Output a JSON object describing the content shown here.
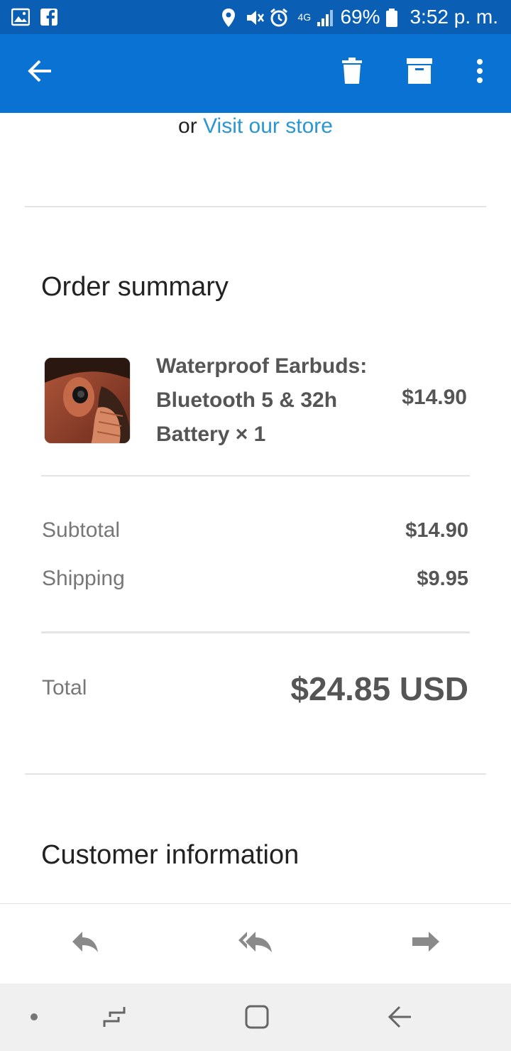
{
  "status_bar": {
    "battery": "69%",
    "network": "4G",
    "time": "3:52 p. m.",
    "icons": [
      "gallery-icon",
      "facebook-icon",
      "location-icon",
      "mute-icon",
      "alarm-icon",
      "signal-icon",
      "battery-icon"
    ]
  },
  "app_bar": {
    "icons": [
      "back-arrow-icon",
      "delete-icon",
      "archive-icon",
      "more-vert-icon"
    ],
    "background": "#0a72d3"
  },
  "email": {
    "visit_prefix": "or",
    "visit_link": "Visit our store",
    "order_summary_title": "Order summary",
    "product": {
      "name": "Waterproof Earbuds: Bluetooth 5 & 32h Battery × 1",
      "price": "$14.90"
    },
    "subtotal_label": "Subtotal",
    "subtotal_value": "$14.90",
    "shipping_label": "Shipping",
    "shipping_value": "$9.95",
    "total_label": "Total",
    "total_value": "$24.85 USD",
    "customer_info_title": "Customer information"
  },
  "action_bar": {
    "icons": [
      "reply-icon",
      "reply-all-icon",
      "forward-icon"
    ]
  },
  "nav_bar": {
    "icons": [
      "dot-icon",
      "recent-apps-icon",
      "home-icon",
      "nav-back-icon"
    ]
  },
  "colors": {
    "status_bar": "#0a5fb4",
    "link": "#2a98cf",
    "text_muted": "#777777"
  }
}
